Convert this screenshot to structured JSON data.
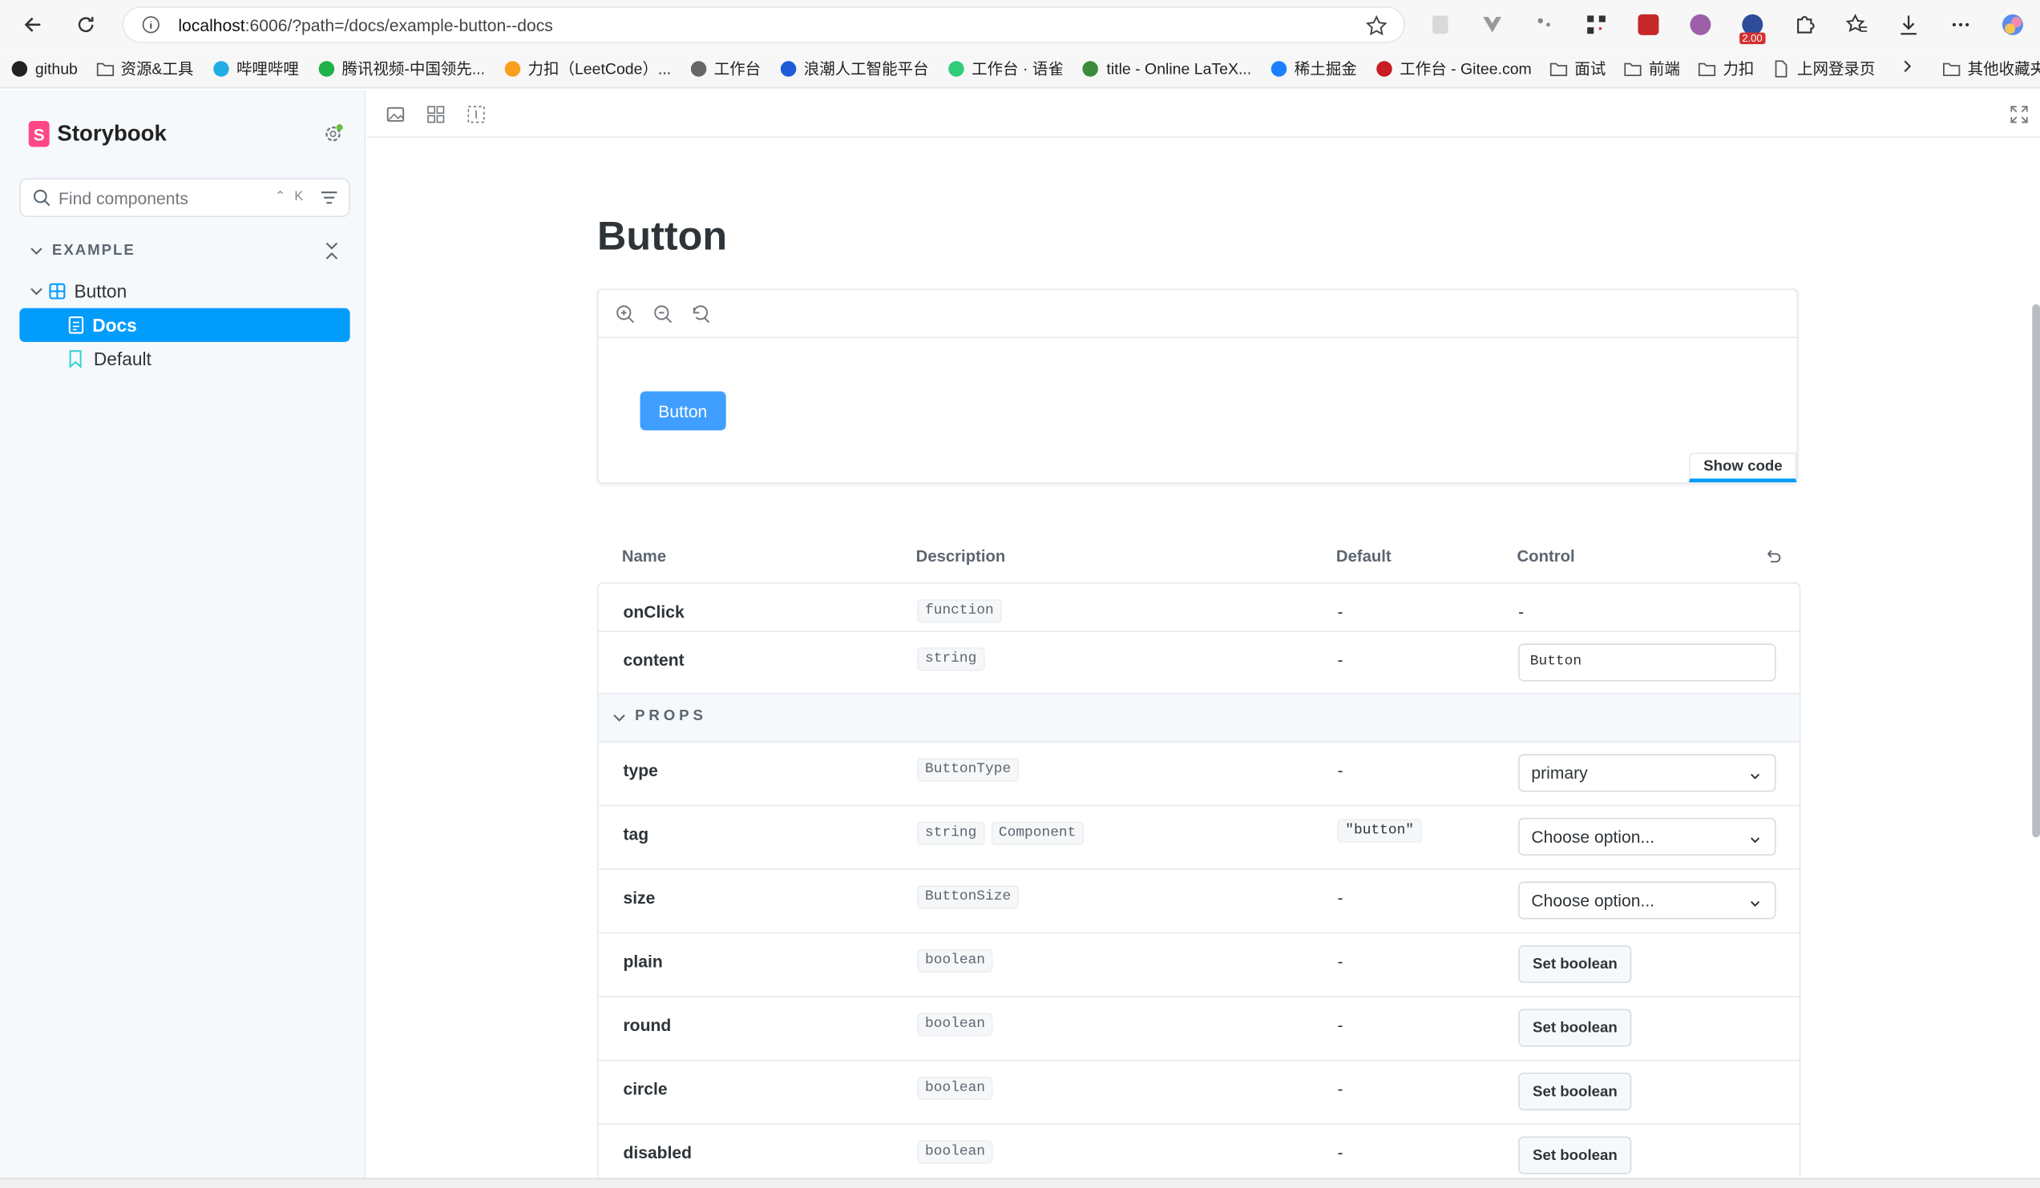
{
  "browser": {
    "url_host": "localhost",
    "url_rest": ":6006/?path=/docs/example-button--docs",
    "bookmarks": [
      {
        "label": "github",
        "icon": "github-icon"
      },
      {
        "label": "资源&工具",
        "icon": "folder-icon"
      },
      {
        "label": "哔哩哔哩",
        "icon": "bilibili-icon"
      },
      {
        "label": "腾讯视频-中国领先...",
        "icon": "tencent-video-icon"
      },
      {
        "label": "力扣（LeetCode）...",
        "icon": "leetcode-icon"
      },
      {
        "label": "工作台",
        "icon": "home-icon"
      },
      {
        "label": "浪潮人工智能平台",
        "icon": "ai-icon"
      },
      {
        "label": "工作台 · 语雀",
        "icon": "yuque-icon"
      },
      {
        "label": "title - Online LaTeX...",
        "icon": "latex-icon"
      },
      {
        "label": "稀土掘金",
        "icon": "juejin-icon"
      },
      {
        "label": "工作台 - Gitee.com",
        "icon": "gitee-icon"
      },
      {
        "label": "面试",
        "icon": "folder-icon"
      },
      {
        "label": "前端",
        "icon": "folder-icon"
      },
      {
        "label": "力扣",
        "icon": "folder-icon"
      },
      {
        "label": "上网登录页",
        "icon": "page-icon"
      }
    ],
    "other_bookmarks": "其他收藏夹",
    "ext_badge": "2.00"
  },
  "sidebar": {
    "brand": "Storybook",
    "search_placeholder": "Find components",
    "search_shortcut": "⌃ K",
    "group": "EXAMPLE",
    "component": "Button",
    "stories": [
      {
        "label": "Docs",
        "selected": true
      },
      {
        "label": "Default",
        "selected": false
      }
    ]
  },
  "docs": {
    "title": "Button",
    "demo_button": "Button",
    "show_code": "Show code",
    "columns": {
      "name": "Name",
      "description": "Description",
      "default": "Default",
      "control": "Control"
    },
    "rows_top": [
      {
        "name": "onClick",
        "types": [
          "function"
        ],
        "default": "-",
        "control": {
          "kind": "none",
          "value": "-"
        }
      },
      {
        "name": "content",
        "types": [
          "string"
        ],
        "default": "-",
        "control": {
          "kind": "text",
          "value": "Button"
        }
      }
    ],
    "section": "PROPS",
    "rows_props": [
      {
        "name": "type",
        "types": [
          "ButtonType"
        ],
        "default": "-",
        "control": {
          "kind": "select",
          "value": "primary"
        }
      },
      {
        "name": "tag",
        "types": [
          "string",
          "Component"
        ],
        "default": "\"button\"",
        "control": {
          "kind": "select",
          "value": "Choose option..."
        }
      },
      {
        "name": "size",
        "types": [
          "ButtonSize"
        ],
        "default": "-",
        "control": {
          "kind": "select",
          "value": "Choose option..."
        }
      },
      {
        "name": "plain",
        "types": [
          "boolean"
        ],
        "default": "-",
        "control": {
          "kind": "bool",
          "value": "Set boolean"
        }
      },
      {
        "name": "round",
        "types": [
          "boolean"
        ],
        "default": "-",
        "control": {
          "kind": "bool",
          "value": "Set boolean"
        }
      },
      {
        "name": "circle",
        "types": [
          "boolean"
        ],
        "default": "-",
        "control": {
          "kind": "bool",
          "value": "Set boolean"
        }
      },
      {
        "name": "disabled",
        "types": [
          "boolean"
        ],
        "default": "-",
        "control": {
          "kind": "bool",
          "value": "Set boolean"
        }
      }
    ]
  },
  "colors": {
    "accent": "#029cfd",
    "brand": "#ff4785",
    "demo_button": "#409eff"
  }
}
